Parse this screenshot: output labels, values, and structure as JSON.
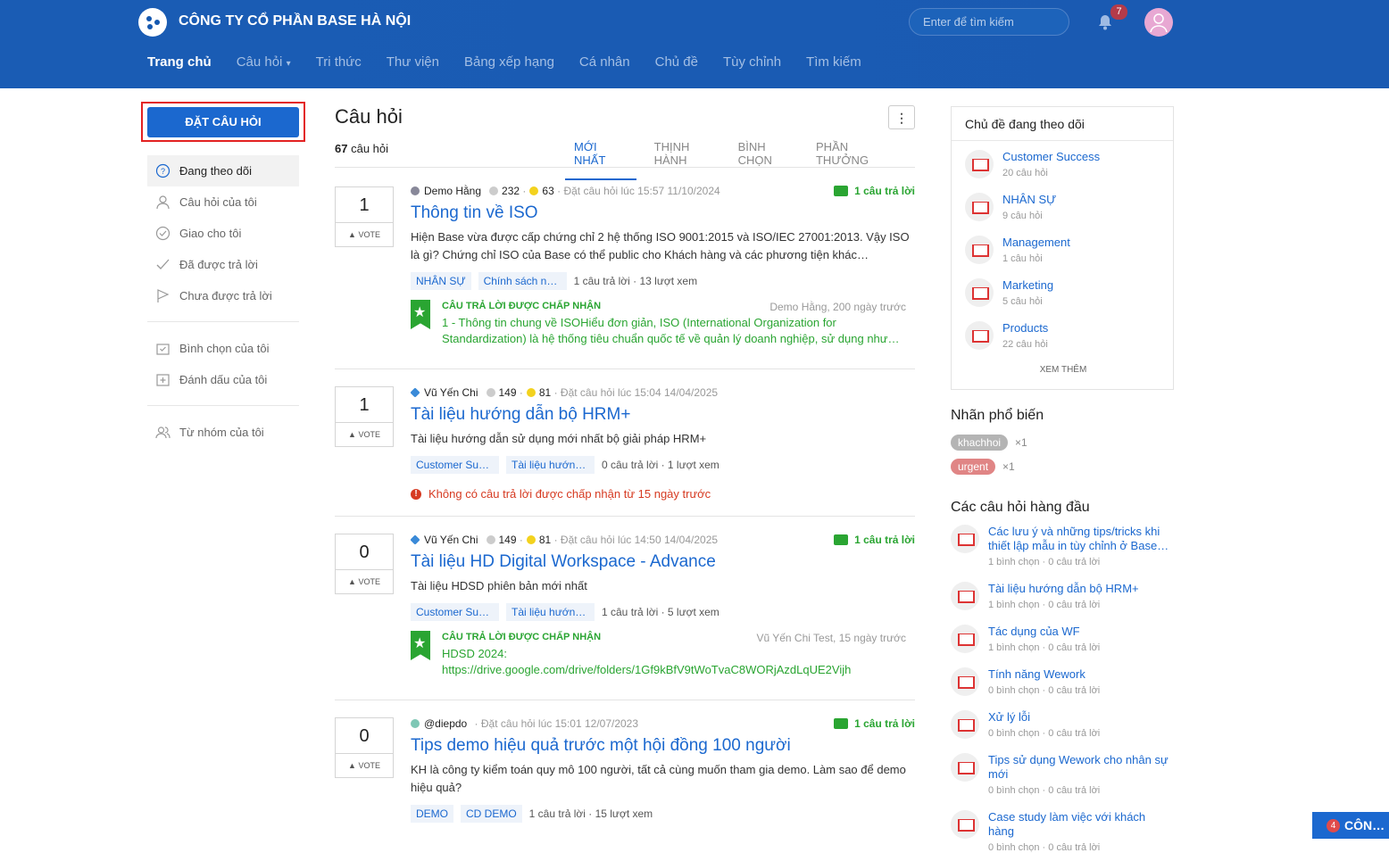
{
  "header": {
    "company": "CÔNG TY CỔ PHẦN BASE HÀ NỘI",
    "search_placeholder": "Enter để tìm kiếm",
    "notif_count": "7",
    "nav": [
      "Trang chủ",
      "Câu hỏi",
      "Tri thức",
      "Thư viện",
      "Bảng xếp hạng",
      "Cá nhân",
      "Chủ đề",
      "Tùy chỉnh",
      "Tìm kiếm"
    ]
  },
  "sidebar": {
    "ask_label": "ĐẶT CÂU HỎI",
    "items": [
      {
        "label": "Đang theo dõi",
        "icon": "question-circle-icon"
      },
      {
        "label": "Câu hỏi của tôi",
        "icon": "user-icon"
      },
      {
        "label": "Giao cho tôi",
        "icon": "check-circle-icon"
      },
      {
        "label": "Đã được trả lời",
        "icon": "check-icon"
      },
      {
        "label": "Chưa được trả lời",
        "icon": "flag-icon"
      },
      {
        "label": "Bình chọn của tôi",
        "icon": "vote-box-icon"
      },
      {
        "label": "Đánh dấu của tôi",
        "icon": "bookmark-add-icon"
      },
      {
        "label": "Từ nhóm của tôi",
        "icon": "group-icon"
      }
    ]
  },
  "main": {
    "title": "Câu hỏi",
    "count": "67",
    "count_label": "câu hỏi",
    "more_icon": "more-vertical-icon",
    "tabs": [
      "MỚI NHẤT",
      "THỊNH HÀNH",
      "BÌNH CHỌN",
      "PHẦN THƯỞNG"
    ],
    "questions": [
      {
        "votes": "1",
        "vote_label": "VOTE",
        "user": "Demo Hằng",
        "rep": "232",
        "gold": "63",
        "asked": "Đặt câu hỏi lúc 15:57 11/10/2024",
        "answers_badge": "1 câu trả lời",
        "title": "Thông tin về ISO",
        "desc": "Hiện Base vừa được cấp chứng chỉ 2 hệ thống ISO 9001:2015 và ISO/IEC 27001:2013. Vậy ISO là gì? Chứng chỉ ISO của Base có thể public cho Khách hàng và các phương tiện khác…",
        "tags": [
          "NHÂN SỰ",
          "Chính sách nhâ…"
        ],
        "stats": "1 câu trả lời · 13 lượt xem",
        "accepted": {
          "heading": "CÂU TRẢ LỜI ĐƯỢC CHẤP NHẬN",
          "by": "Demo Hằng, 200 ngày trước",
          "text": "1 - Thông tin chung về ISOHiểu đơn giản, ISO (International Organization for Standardization) là hệ thống tiêu chuẩn quốc tế về quản lý doanh nghiệp, sử dụng như…"
        }
      },
      {
        "votes": "1",
        "vote_label": "VOTE",
        "user": "Vũ Yến Chi",
        "rep": "149",
        "gold": "81",
        "asked": "Đặt câu hỏi lúc 15:04 14/04/2025",
        "title": "Tài liệu hướng dẫn bộ HRM+",
        "desc": "Tài liệu hướng dẫn sử dụng mới nhất bộ giải pháp HRM+",
        "tags": [
          "Customer Succ…",
          "Tài liệu hướng …"
        ],
        "stats": "0 câu trả lời · 1 lượt xem",
        "warning": "Không có câu trả lời được chấp nhận từ 15 ngày trước"
      },
      {
        "votes": "0",
        "vote_label": "VOTE",
        "user": "Vũ Yến Chi",
        "rep": "149",
        "gold": "81",
        "asked": "Đặt câu hỏi lúc 14:50 14/04/2025",
        "answers_badge": "1 câu trả lời",
        "title": "Tài liệu HD Digital Workspace - Advance",
        "desc": "Tài liệu HDSD phiên bản mới nhất",
        "tags": [
          "Customer Succ…",
          "Tài liệu hướng …"
        ],
        "stats": "1 câu trả lời · 5 lượt xem",
        "accepted": {
          "heading": "CÂU TRẢ LỜI ĐƯỢC CHẤP NHẬN",
          "by": "Vũ Yến Chi Test, 15 ngày trước",
          "text": "HDSD 2024:\nhttps://drive.google.com/drive/folders/1Gf9kBfV9tWoTvaC8WORjAzdLqUE2Vijh"
        }
      },
      {
        "votes": "0",
        "vote_label": "VOTE",
        "user": "@diepdo",
        "asked": "Đặt câu hỏi lúc 15:01 12/07/2023",
        "answers_badge": "1 câu trả lời",
        "title": "Tips demo hiệu quả trước một hội đồng 100 người",
        "desc": "KH là công ty kiểm toán quy mô 100 người, tất cả cùng muốn tham gia demo. Làm sao để demo hiệu quả?",
        "tags": [
          "DEMO",
          "CD DEMO"
        ],
        "stats": "1 câu trả lời · 15 lượt xem"
      }
    ]
  },
  "right": {
    "followed_title": "Chủ đề đang theo dõi",
    "see_more": "XEM THÊM",
    "topics": [
      {
        "name": "Customer Success",
        "sub": "20 câu hỏi"
      },
      {
        "name": "NHÂN SỰ",
        "sub": "9 câu hỏi"
      },
      {
        "name": "Management",
        "sub": "1 câu hỏi"
      },
      {
        "name": "Marketing",
        "sub": "5 câu hỏi"
      },
      {
        "name": "Products",
        "sub": "22 câu hỏi"
      }
    ],
    "labels_title": "Nhãn phổ biến",
    "labels": [
      {
        "name": "khachhoi",
        "count": "×1",
        "color": "#b4b4b4"
      },
      {
        "name": "urgent",
        "count": "×1",
        "color": "#e08585"
      }
    ],
    "top_title": "Các câu hỏi hàng đầu",
    "top": [
      {
        "name": "Các lưu ý và những tips/tricks khi thiết lập mẫu in tùy chỉnh ở Base…",
        "sub": "1 bình chọn · 0 câu trả lời"
      },
      {
        "name": "Tài liệu hướng dẫn bộ HRM+",
        "sub": "1 bình chọn · 0 câu trả lời"
      },
      {
        "name": "Tác dụng của WF",
        "sub": "1 bình chọn · 0 câu trả lời"
      },
      {
        "name": "Tính năng Wework",
        "sub": "0 bình chọn · 0 câu trả lời"
      },
      {
        "name": "Xử lý lỗi",
        "sub": "0 bình chọn · 0 câu trả lời"
      },
      {
        "name": "Tips sử dụng Wework cho nhân sự mới",
        "sub": "0 bình chọn · 0 câu trả lời"
      },
      {
        "name": "Case study làm việc với khách hàng",
        "sub": "0 bình chọn · 0 câu trả lời"
      }
    ]
  },
  "chat": {
    "count": "4",
    "label": "CÔN…"
  }
}
